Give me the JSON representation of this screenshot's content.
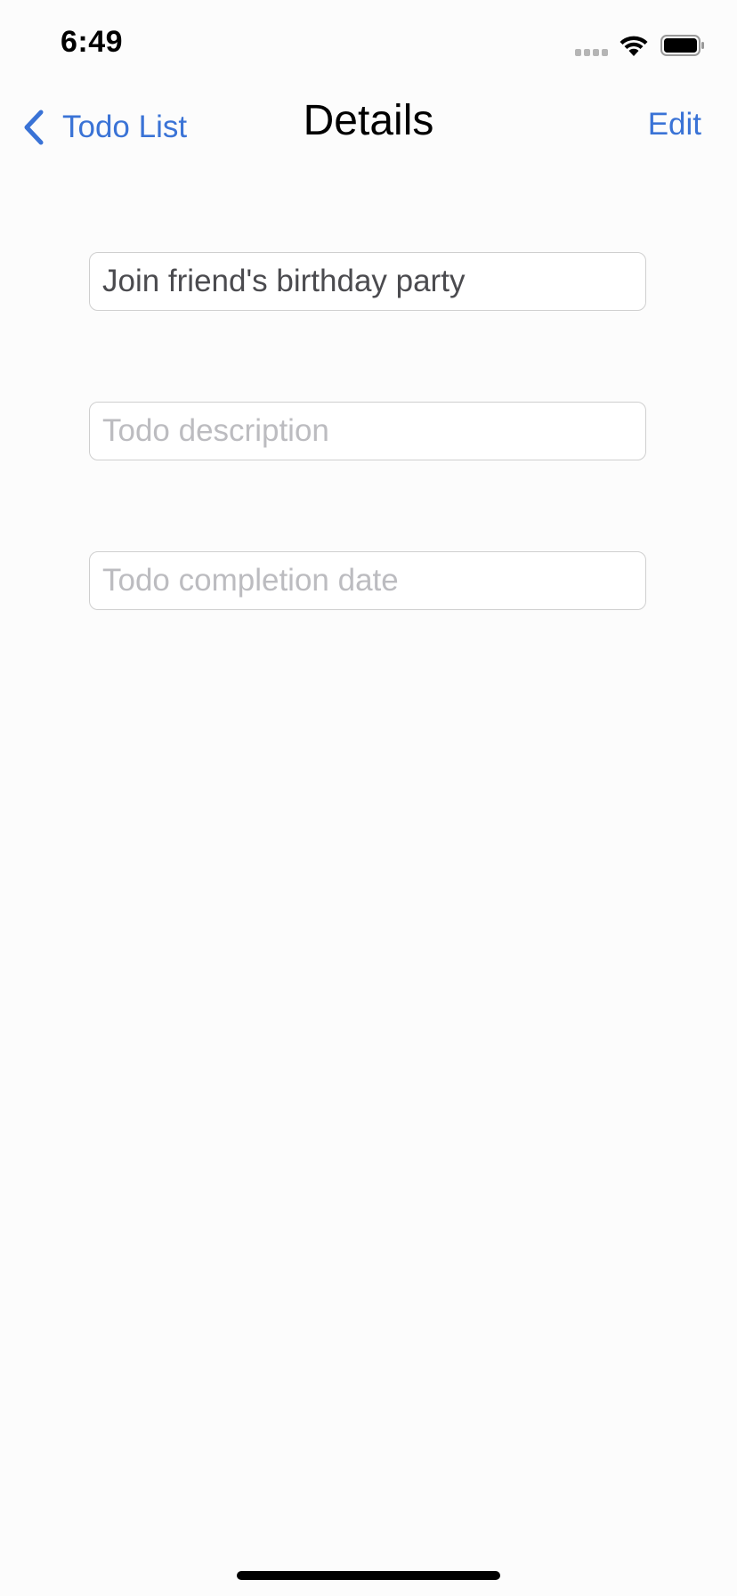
{
  "status_bar": {
    "time": "6:49"
  },
  "nav": {
    "back_label": "Todo List",
    "title": "Details",
    "edit_label": "Edit"
  },
  "fields": {
    "title_value": "Join friend's birthday party",
    "description_placeholder": "Todo description",
    "description_value": "",
    "date_placeholder": "Todo completion date",
    "date_value": ""
  },
  "icons": {
    "back": "chevron-left-icon",
    "signal": "cellular-signal-icon",
    "wifi": "wifi-icon",
    "battery": "battery-icon"
  },
  "colors": {
    "accent": "#3a73d6",
    "background": "#fcfcfc",
    "placeholder": "#bcbcc0",
    "text": "#4b4b4f"
  }
}
